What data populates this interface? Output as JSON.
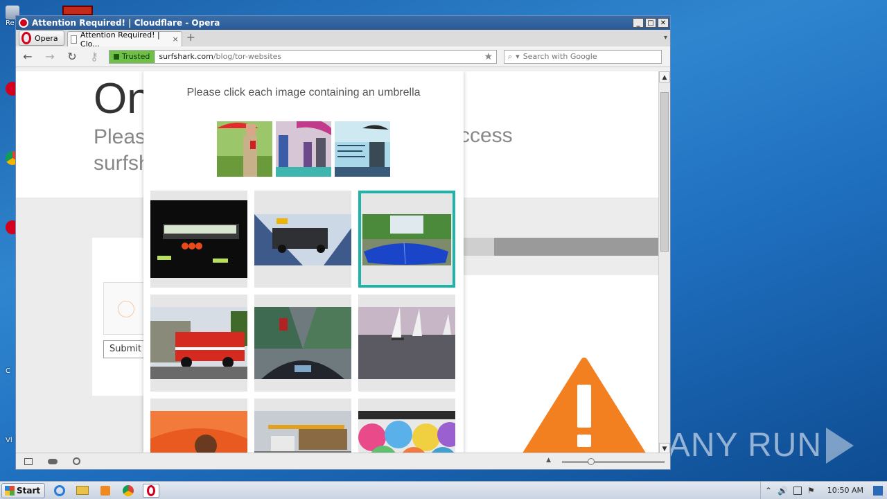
{
  "desktop": {
    "watermark": "ANY RUN",
    "icon_labels": [
      "Re",
      "C",
      "Vl"
    ]
  },
  "window": {
    "title": "Attention Required! | Cloudflare - Opera",
    "controls": [
      "_",
      "□",
      "✕"
    ]
  },
  "tabs": {
    "opera_menu": "Opera",
    "active_tab": "Attention Required! | Clo...",
    "close": "×",
    "new_tab": "+",
    "overflow": "▾"
  },
  "navbar": {
    "back": "←",
    "forward": "→",
    "reload": "↻",
    "key": "⚷",
    "trusted_label": "Trusted",
    "url_host": "surfshark.com",
    "url_path": "/blog/tor-websites",
    "bookmark": "★",
    "search_placeholder": "Search with Google",
    "search_icon": "⌕"
  },
  "page": {
    "bg_title": "On",
    "bg_sub_line1": "Pleas",
    "bg_sub_line2": "surfsh",
    "bg_sub_right": "ccess",
    "submit_label": "Submit"
  },
  "challenge": {
    "prompt": "Please click each image containing an umbrella",
    "samples": [
      "sample-1",
      "sample-2",
      "sample-3"
    ],
    "grid": [
      {
        "id": "cell-1",
        "selected": false
      },
      {
        "id": "cell-2",
        "selected": false
      },
      {
        "id": "cell-3",
        "selected": true
      },
      {
        "id": "cell-4",
        "selected": false
      },
      {
        "id": "cell-5",
        "selected": false
      },
      {
        "id": "cell-6",
        "selected": false
      },
      {
        "id": "cell-7",
        "selected": false
      },
      {
        "id": "cell-8",
        "selected": false
      },
      {
        "id": "cell-9",
        "selected": false
      }
    ],
    "accent_color": "#1fb3a9"
  },
  "statusbar": {
    "icons": [
      "panel-icon",
      "cloud-icon",
      "speed-dial-icon"
    ],
    "zoom_caret": "▲"
  },
  "taskbar": {
    "start_label": "Start",
    "clock": "10:50 AM",
    "tray_arrow": "⌃",
    "tray_volume": "🔊",
    "tray_flag": "⚑"
  }
}
